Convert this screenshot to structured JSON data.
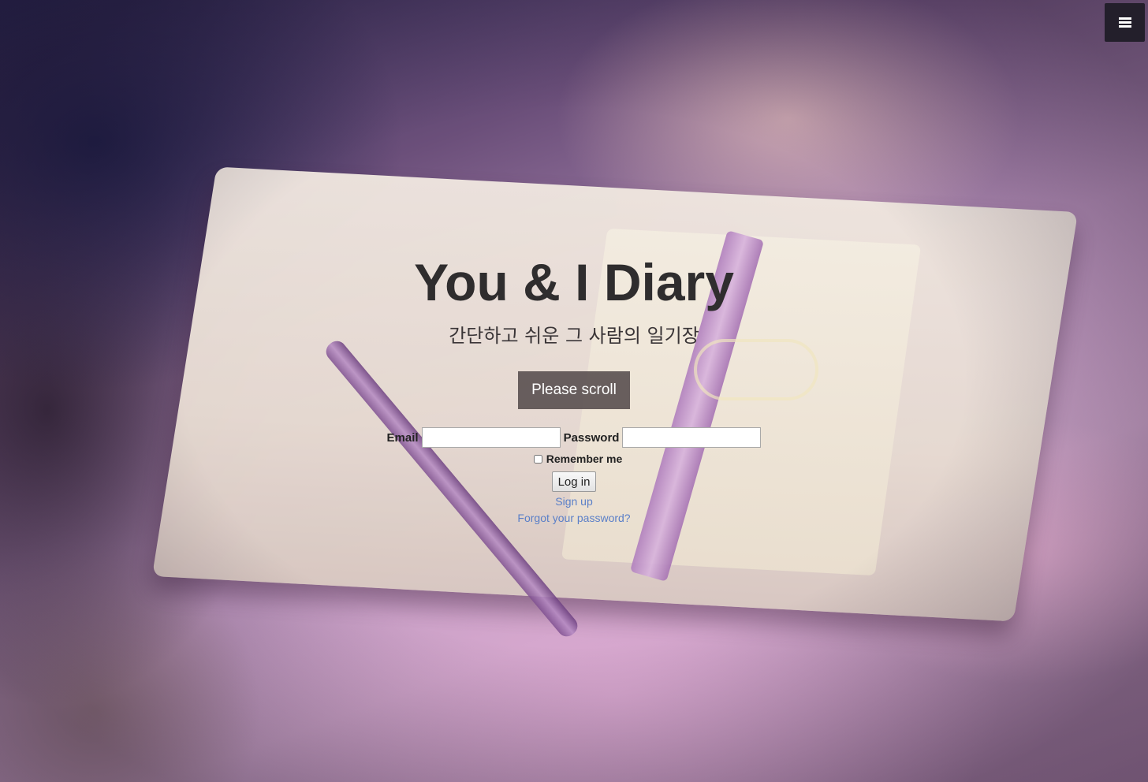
{
  "hero": {
    "title": "You & I Diary",
    "subtitle": "간단하고 쉬운 그 사람의 일기장",
    "scroll_label": "Please scroll"
  },
  "menu": {
    "icon": "hamburger-menu-icon"
  },
  "login_form": {
    "email_label": "Email",
    "email_value": "",
    "password_label": "Password",
    "password_value": "",
    "remember_label": "Remember me",
    "remember_checked": false,
    "login_label": "Log in",
    "signup_link": "Sign up",
    "forgot_link": "Forgot your password?"
  },
  "colors": {
    "title": "#2f2d2e",
    "menu_bg": "#231f2b",
    "scroll_button_bg": "#504648",
    "link": "#5a7fc8"
  }
}
